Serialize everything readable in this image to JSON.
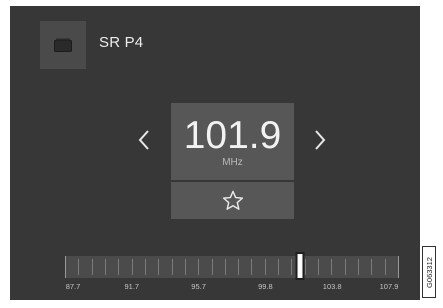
{
  "station": {
    "name": "SR P4",
    "icon": "radio-station-icon"
  },
  "tuner_display": {
    "frequency": "101.9",
    "unit": "MHz",
    "prev_icon": "chevron-left-icon",
    "next_icon": "chevron-right-icon",
    "favorite_icon": "star-outline-icon"
  },
  "tuner_scale": {
    "labels": [
      "87.7",
      "91.7",
      "95.7",
      "99.8",
      "103.8",
      "107.9"
    ],
    "min": 87.7,
    "max": 107.9,
    "current": 101.9
  },
  "figure_code": "G063312",
  "colors": {
    "screen_bg": "#373737",
    "panel_bg": "#575757",
    "text": "#f2f2f2"
  }
}
